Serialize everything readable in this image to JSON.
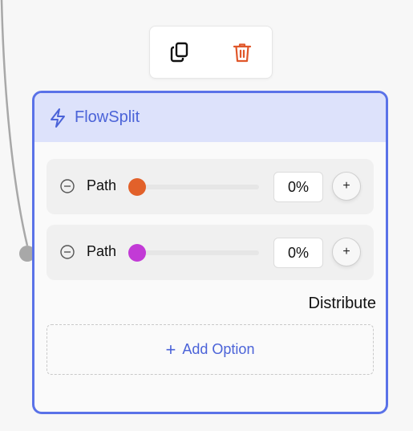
{
  "toolbar": {
    "copy_icon": "copy-icon",
    "delete_icon": "trash-icon",
    "delete_color": "#e0572a"
  },
  "node": {
    "title": "FlowSplit",
    "title_icon": "lightning-icon",
    "accent": "#5a72e8",
    "header_bg": "#dde2fb"
  },
  "paths": [
    {
      "label": "Path",
      "color": "#e2612a",
      "value": 0,
      "percent": "0%",
      "add_label": "+"
    },
    {
      "label": "Path",
      "color": "#c23ad6",
      "value": 0,
      "percent": "0%",
      "add_label": "+"
    }
  ],
  "distribute_label": "Distribute",
  "add_option": {
    "icon": "+",
    "label": "Add Option"
  }
}
